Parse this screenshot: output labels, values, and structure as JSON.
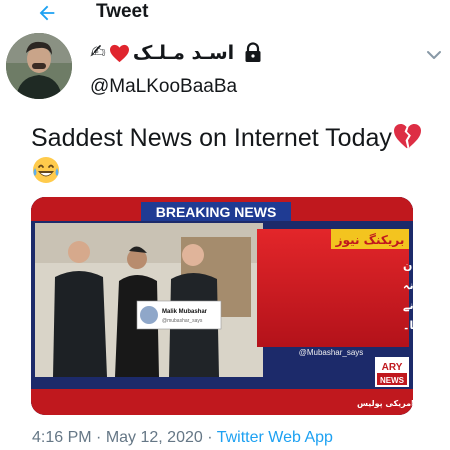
{
  "header": {
    "title": "Tweet",
    "back_icon": "arrow-left-icon",
    "accent": "#1da1f2"
  },
  "author": {
    "display_name_emoji": "✍",
    "display_name": "اسـد مـلـک",
    "handle": "@MaLKooBaaBa",
    "protected_icon": "lock-icon",
    "menu_icon": "chevron-down-icon"
  },
  "tweet": {
    "text_line1": "Saddest News on Internet Today",
    "emoji_1": "broken-heart-icon",
    "emoji_2": "laughing-tears-icon"
  },
  "media": {
    "banner": "BREAKING NEWS",
    "urdu_tag": "بریکنگ نیوز",
    "urdu_headline": [
      "پاکستان کے معروف سابقہ ان",
      "لڈن جعفری کو کرونا کا علاج نہ",
      "بتانے پر امریکی پولیس نے",
      "گرفتار کر لیا۔"
    ],
    "ticker": "عدم ہر طرح چھڑول کے باوجود ایک ہی بات ۔ میں نہیں بتاؤں گا یہ اقا ہے ۔ امریکی پولیس",
    "watermark": "@Mubashar_says",
    "inset_name": "Malik Mubashar",
    "inset_handle": "@mubashar_says",
    "logo_top": "ARY",
    "logo_bottom": "NEWS"
  },
  "meta": {
    "time": "4:16 PM",
    "separator": " · ",
    "date": "May 12, 2020",
    "app": "Twitter Web App"
  }
}
